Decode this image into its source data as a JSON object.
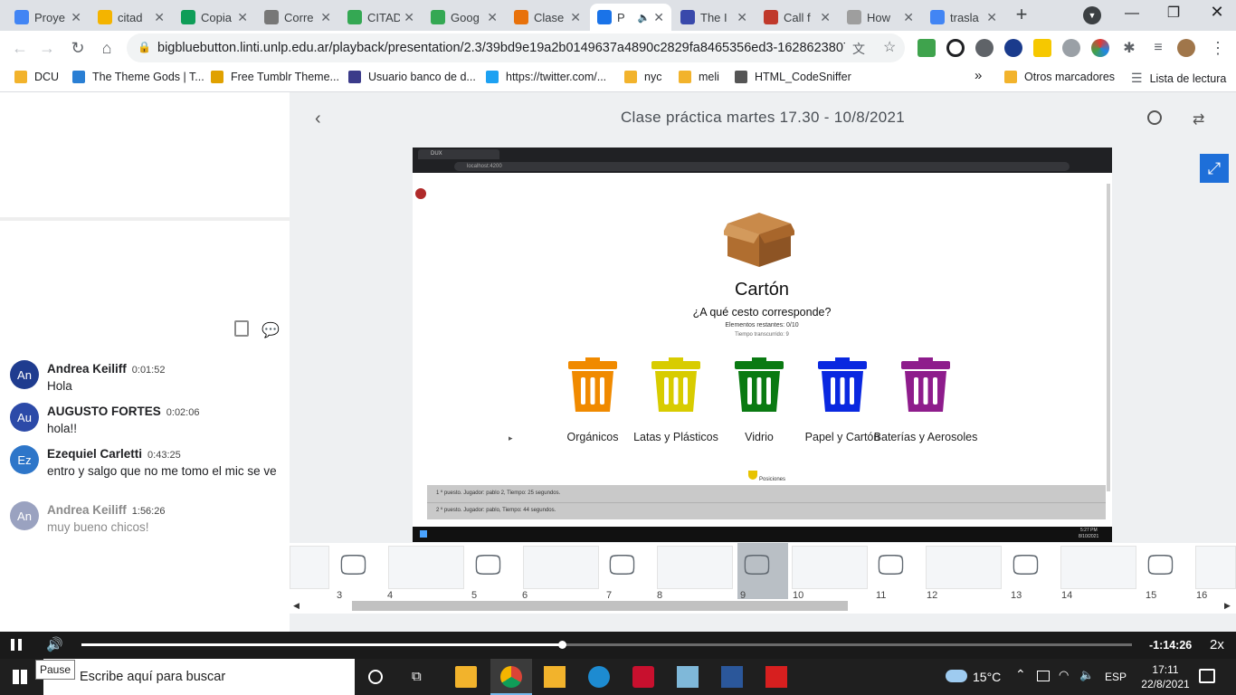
{
  "browser": {
    "tabs": [
      {
        "title": "Proye",
        "color": "#4285f4"
      },
      {
        "title": "citad",
        "color": "#f4b400"
      },
      {
        "title": "Copia",
        "color": "#0f9d58"
      },
      {
        "title": "Corre",
        "color": "#777777"
      },
      {
        "title": "CITAD",
        "color": "#34a853"
      },
      {
        "title": "Goog",
        "color": "#34a853"
      },
      {
        "title": "Clase",
        "color": "#e8710a"
      },
      {
        "title": "P",
        "color": "#1a73e8"
      },
      {
        "title": "The I",
        "color": "#3949ab"
      },
      {
        "title": "Call f",
        "color": "#c0392b"
      },
      {
        "title": "How",
        "color": "#9e9e9e"
      },
      {
        "title": "trasla",
        "color": "#4285f4"
      }
    ],
    "url": "bigbluebutton.linti.unlp.edu.ar/playback/presentation/2.3/39bd9e19a2b0149637a4890c2829fa8465356ed3-16286238070...",
    "bookmarks": [
      {
        "label": "DCU",
        "color": "#f2b32c"
      },
      {
        "label": "The Theme Gods | T...",
        "color": "#2a7fd4"
      },
      {
        "label": "Free Tumblr Theme...",
        "color": "#e0a100"
      },
      {
        "label": "Usuario banco de d...",
        "color": "#3b3b8a"
      },
      {
        "label": "https://twitter.com/...",
        "color": "#1da1f2"
      },
      {
        "label": "nyc",
        "color": "#f2b32c"
      },
      {
        "label": "meli",
        "color": "#f2b32c"
      },
      {
        "label": "HTML_CodeSniffer",
        "color": "#555555"
      }
    ],
    "more_bookmarks": "»",
    "other_bookmarks": "Otros marcadores",
    "reading_list": "Lista de lectura"
  },
  "presentation": {
    "title": "Clase práctica martes 17.30 - 10/8/2021"
  },
  "chat": {
    "messages": [
      {
        "initials": "An",
        "name": "Andrea Keiliff",
        "time": "0:01:52",
        "text": "Hola",
        "color": "#1f3c8f",
        "faded": false
      },
      {
        "initials": "Au",
        "name": "AUGUSTO FORTES",
        "time": "0:02:06",
        "text": "hola!!",
        "color": "#2c4aa8",
        "faded": false
      },
      {
        "initials": "Ez",
        "name": "Ezequiel Carletti",
        "time": "0:43:25",
        "text": "entro y salgo que no me tomo el mic se ve",
        "color": "#2e76c9",
        "faded": false
      },
      {
        "initials": "An",
        "name": "Andrea Keiliff",
        "time": "1:56:26",
        "text": "muy bueno chicos!",
        "color": "#9aa2c0",
        "faded": true
      }
    ]
  },
  "slide": {
    "browser_tab": "DUX",
    "browser_url": "localhost:4200",
    "item_title": "Cartón",
    "question": "¿A qué cesto corresponde?",
    "remaining": "Elementos restantes: 0/10",
    "elapsed": "Tiempo transcurrido: 9",
    "bins": [
      {
        "label": "Orgánicos",
        "color": "#f08a00"
      },
      {
        "label": "Latas y Plásticos",
        "color": "#d8cc00"
      },
      {
        "label": "Vidrio",
        "color": "#0a7a12"
      },
      {
        "label": "Papel y Cartón",
        "color": "#0a28e0"
      },
      {
        "label": "Baterías y Aerosoles",
        "color": "#8e1c8c"
      }
    ],
    "positions_label": "Posiciones",
    "rankings": [
      "1 º puesto. Jugador: pablo 2, Tiempo: 25 segundos.",
      "2 º puesto. Jugador: pablo, Tiempo: 44 segundos."
    ],
    "clock_time": "5:27 PM",
    "clock_date": "8/10/2021"
  },
  "thumbnails": {
    "numbers": [
      "3",
      "4",
      "5",
      "6",
      "7",
      "8",
      "9",
      "10",
      "11",
      "12",
      "13",
      "14",
      "15",
      "16"
    ]
  },
  "player": {
    "time_remaining": "-1:14:26",
    "speed": "2x",
    "tooltip": "Pause",
    "progress": 0.457
  },
  "taskbar": {
    "search_placeholder": "Escribe aquí para buscar",
    "temperature": "15°C",
    "language": "ESP",
    "time": "17:11",
    "date": "22/8/2021"
  }
}
